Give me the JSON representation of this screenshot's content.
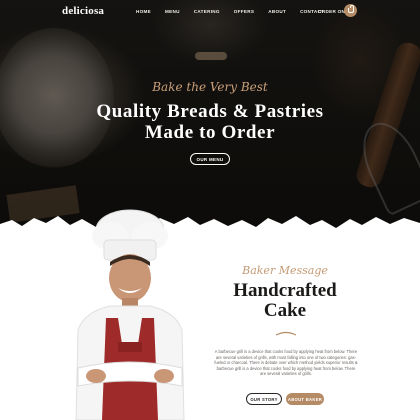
{
  "brand": {
    "logo": "deliciosa"
  },
  "nav": {
    "items": [
      "HOME",
      "MENU",
      "CATERING",
      "OFFERS",
      "ABOUT",
      "CONTACT"
    ],
    "order_online": "ORDER ONLINE"
  },
  "hero": {
    "tagline": "Bake the Very Best",
    "headline_line1": "Quality Breads & Pastries",
    "headline_line2": "Made to Order",
    "cta": "OUR MENU"
  },
  "about": {
    "script": "Baker Message",
    "title_line1": "Handcrafted",
    "title_line2": "Cake",
    "body": "A barbecue grill is a device that cooks food by applying heat from below. There are several varieties of grills, with most falling into one of two categories: gas-fueled or charcoal. There is debate over which method yields superior results & barbecue grill is a device that cooks food by applying heat from below. There are several varieties of grills.",
    "button_story": "OUR STORY",
    "button_more": "ABOUT BAKER"
  },
  "colors": {
    "accent": "#b58b66",
    "script": "#c9a07a",
    "dark": "#141210",
    "white": "#ffffff"
  }
}
